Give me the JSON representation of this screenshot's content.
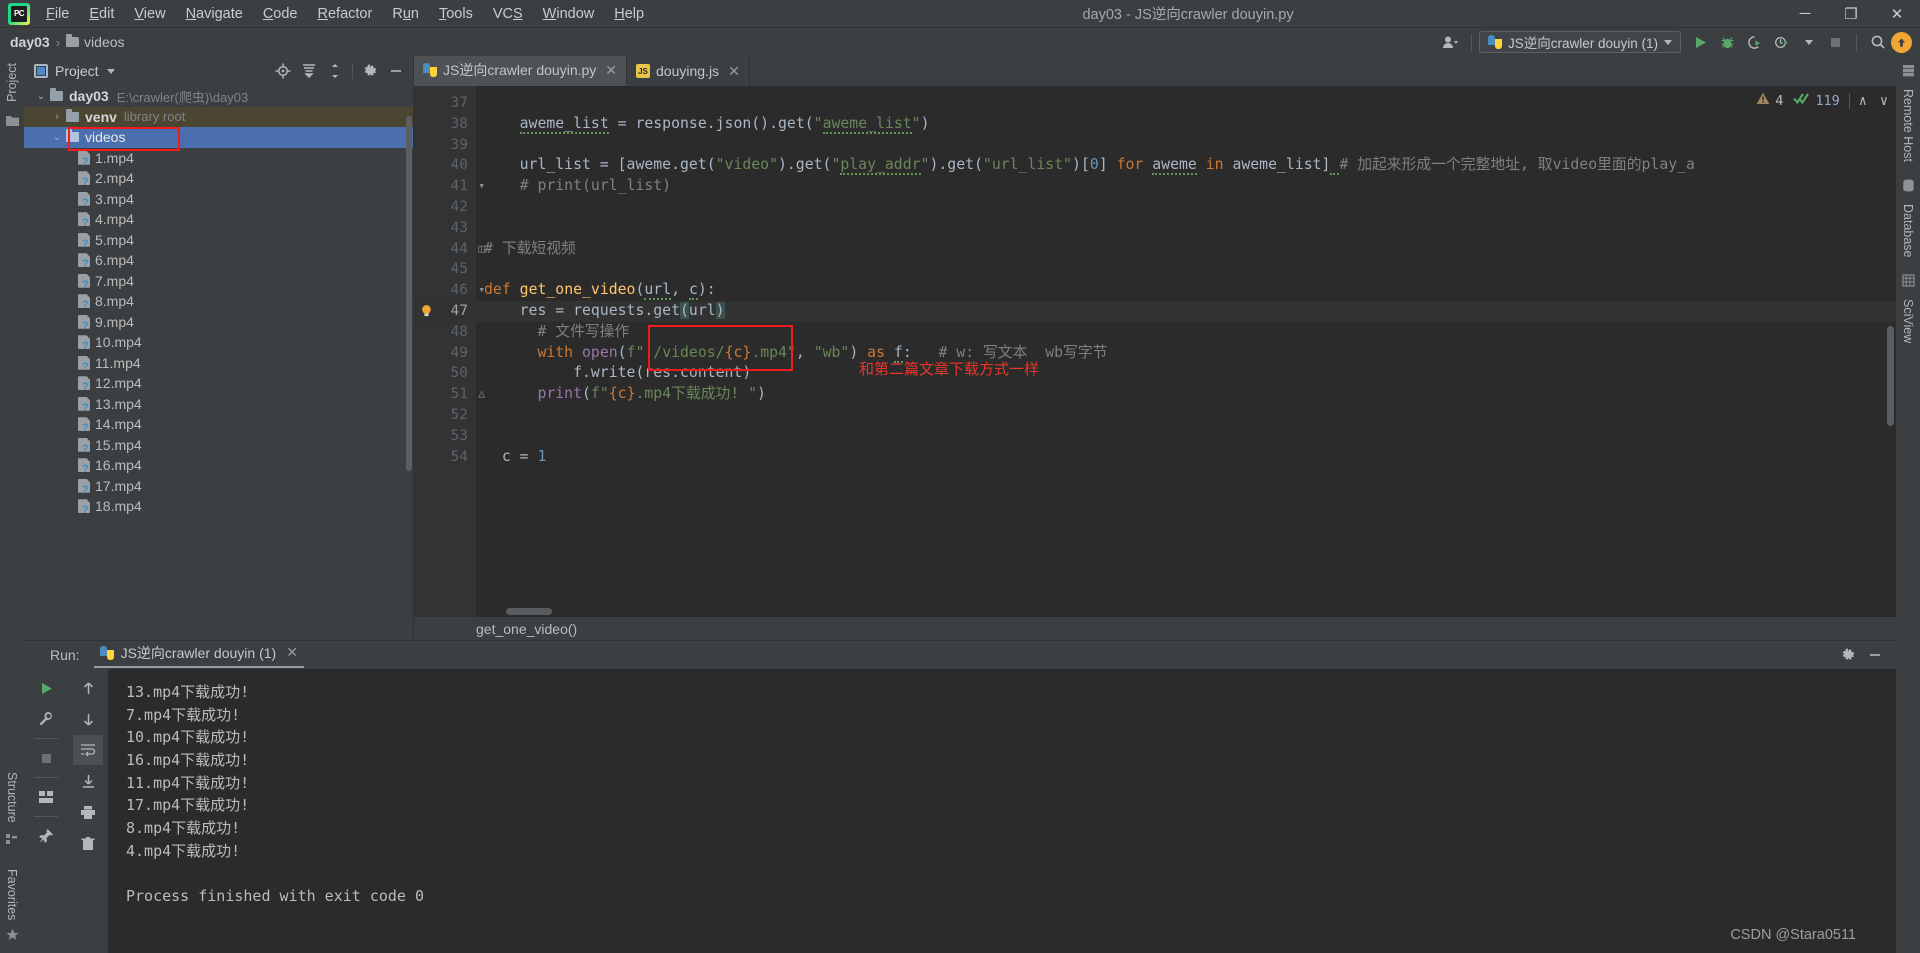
{
  "window": {
    "title": "day03 - JS逆向crawler douyin.py",
    "minimize": "─",
    "maximize": "❐",
    "close": "✕"
  },
  "menu": {
    "items": [
      "File",
      "Edit",
      "View",
      "Navigate",
      "Code",
      "Refactor",
      "Run",
      "Tools",
      "VCS",
      "Window",
      "Help"
    ]
  },
  "breadcrumb": {
    "project": "day03",
    "separator": "›",
    "folder": "videos"
  },
  "toolbar": {
    "run_config": "JS逆向crawler douyin (1)",
    "run_icon": "run-icon",
    "debug_icon": "debug-icon",
    "coverage_icon": "coverage-icon",
    "profile_icon": "profile-icon",
    "stop_icon": "stop-icon",
    "search_icon": "search-icon",
    "update_icon": "update-icon",
    "user_icon": "user-icon"
  },
  "project_pane": {
    "title": "Project",
    "tools": [
      "locate-icon",
      "collapse-all-icon",
      "expand-icon",
      "settings-icon",
      "hide-icon"
    ],
    "tree": [
      {
        "label": "day03",
        "path": "E:\\crawler(爬虫)\\day03",
        "type": "root",
        "arrow": "∨"
      },
      {
        "label": "venv",
        "hint": "library root",
        "type": "folder",
        "arrow": "›"
      },
      {
        "label": "videos",
        "type": "folder-open",
        "arrow": "∨",
        "selected": true
      }
    ],
    "files": [
      "1.mp4",
      "2.mp4",
      "3.mp4",
      "4.mp4",
      "5.mp4",
      "6.mp4",
      "7.mp4",
      "8.mp4",
      "9.mp4",
      "10.mp4",
      "11.mp4",
      "12.mp4",
      "13.mp4",
      "14.mp4",
      "15.mp4",
      "16.mp4",
      "17.mp4",
      "18.mp4"
    ]
  },
  "left_strip": {
    "labels": [
      "Project"
    ]
  },
  "left_strip_bottom": {
    "labels": [
      "Structure",
      "Favorites"
    ]
  },
  "right_strip": {
    "labels": [
      "Remote Host",
      "Database",
      "SciView"
    ]
  },
  "editor": {
    "tabs": [
      {
        "label": "JS逆向crawler douyin.py",
        "icon": "python-file-icon",
        "active": true
      },
      {
        "label": "douying.js",
        "icon": "javascript-file-icon",
        "active": false
      }
    ],
    "first_line_number": 37,
    "current_line": 47,
    "lines": [
      {
        "n": 37,
        "text": ""
      },
      {
        "n": 38,
        "text": "    aweme_list = response.json().get(\"aweme_list\")"
      },
      {
        "n": 39,
        "text": ""
      },
      {
        "n": 40,
        "text": "    url_list = [aweme.get(\"video\").get(\"play_addr\").get(\"url_list\")[0] for aweme in aweme_list]  # 加起来形成一个完整地址, 取video里面的play_a"
      },
      {
        "n": 41,
        "text": "    # print(url_list)"
      },
      {
        "n": 42,
        "text": ""
      },
      {
        "n": 43,
        "text": ""
      },
      {
        "n": 44,
        "text": "# 下载短视频"
      },
      {
        "n": 45,
        "text": ""
      },
      {
        "n": 46,
        "text": "def get_one_video(url, c):"
      },
      {
        "n": 47,
        "text": "    res = requests.get(url)"
      },
      {
        "n": 48,
        "text": "      # 文件写操作"
      },
      {
        "n": 49,
        "text": "      with open(f\"./videos/{c}.mp4\", \"wb\") as f:   # w: 写文本  wb写字节"
      },
      {
        "n": 50,
        "text": "          f.write(res.content)"
      },
      {
        "n": 51,
        "text": "      print(f\"{c}.mp4下载成功! \")"
      },
      {
        "n": 52,
        "text": ""
      },
      {
        "n": 53,
        "text": ""
      },
      {
        "n": 54,
        "text": "  c = 1"
      }
    ],
    "annotation_text": "和第二篇文章下载方式一样",
    "bottom_breadcrumb": "get_one_video()",
    "inspection": {
      "warning_icon": "warning-icon",
      "warning_count": "4",
      "ok_icon": "inspection-ok-icon",
      "ok_count": "119",
      "prev_icon": "∧",
      "next_icon": "∨"
    }
  },
  "run_panel": {
    "label": "Run:",
    "tab": "JS逆向crawler douyin (1)",
    "close_icon": "✕",
    "settings_icon": "gear-icon",
    "hide_icon": "─",
    "tools": [
      "rerun-icon",
      "wrench-icon",
      "stop-icon",
      "layout-icon",
      "pin-icon"
    ],
    "tools2": [
      "up-icon",
      "down-icon",
      "soft-wrap-icon",
      "scroll-end-icon",
      "print-icon",
      "trash-icon"
    ],
    "console": [
      "13.mp4下载成功!",
      "7.mp4下载成功!",
      "10.mp4下载成功!",
      "16.mp4下载成功!",
      "11.mp4下载成功!",
      "17.mp4下载成功!",
      "8.mp4下载成功!",
      "4.mp4下载成功!",
      "",
      "Process finished with exit code 0"
    ]
  },
  "watermark": "CSDN @Stara0511",
  "colors": {
    "accent_blue": "#4b6eaf",
    "annotation_red": "#f01c1c",
    "background": "#3c3f41",
    "editor_bg": "#2b2b2b",
    "keyword": "#cc7832",
    "string": "#6a8759",
    "number": "#6897bb",
    "function": "#ffc66d",
    "comment": "#808080"
  }
}
